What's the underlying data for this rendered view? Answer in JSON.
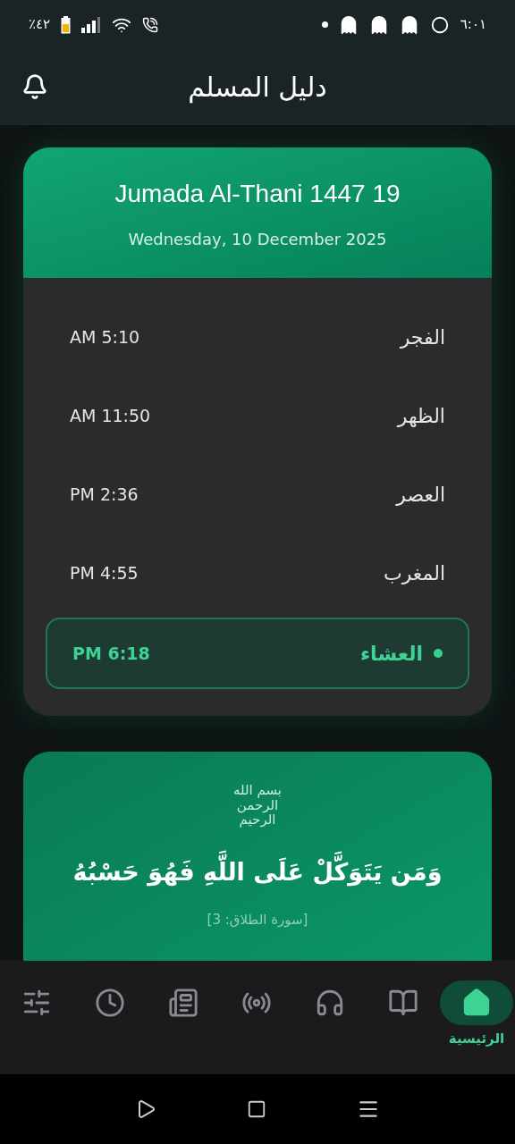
{
  "status_bar": {
    "time": "٦:٠١",
    "battery": "٤٢٪"
  },
  "app_bar": {
    "title": "دليل المسلم"
  },
  "date_card": {
    "hijri": "Jumada Al-Thani 1447 19",
    "gregorian": "Wednesday, 10 December 2025"
  },
  "prayers": [
    {
      "name": "الفجر",
      "time": "AM 5:10",
      "selected": false
    },
    {
      "name": "الظهر",
      "time": "AM 11:50",
      "selected": false
    },
    {
      "name": "العصر",
      "time": "PM 2:36",
      "selected": false
    },
    {
      "name": "المغرب",
      "time": "PM 4:55",
      "selected": false
    },
    {
      "name": "العشاء",
      "time": "PM 6:18",
      "selected": true
    }
  ],
  "verse_card": {
    "basmala": "بسم الله الرحمن الرحيم",
    "verse": "وَمَن يَتَوَكَّلْ عَلَى اللَّهِ فَهُوَ حَسْبُهُ",
    "source": "[سورة الطلاق: 3]"
  },
  "bottom_nav": [
    {
      "label": "الرئيسية",
      "selected": true
    },
    {
      "selected": false
    },
    {
      "selected": false
    },
    {
      "selected": false
    },
    {
      "selected": false
    },
    {
      "selected": false
    },
    {
      "selected": false
    }
  ]
}
